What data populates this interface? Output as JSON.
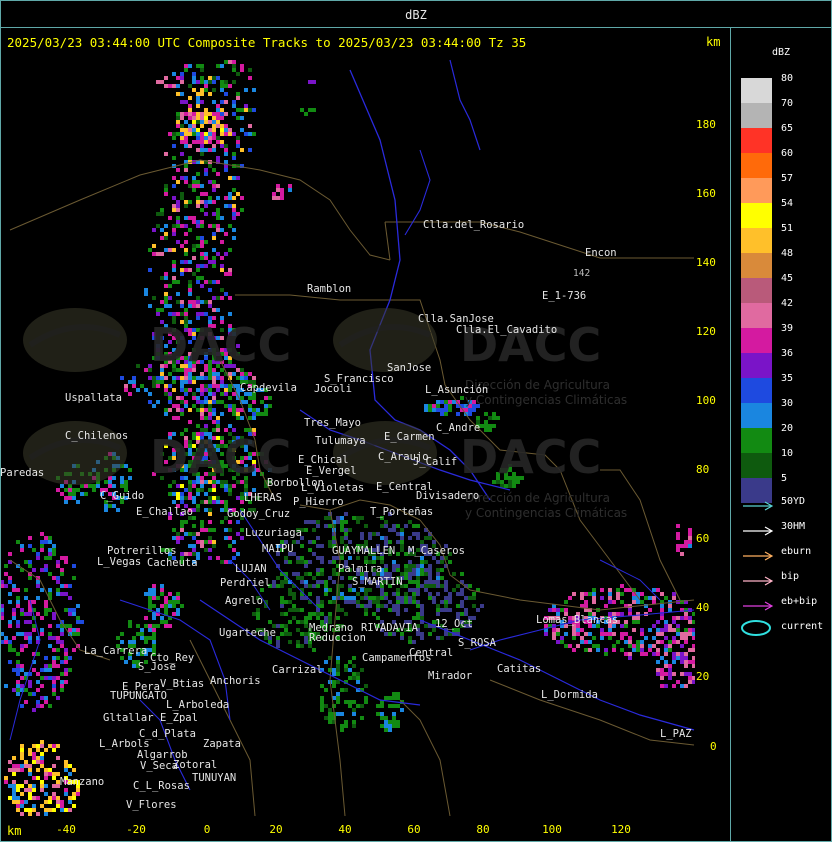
{
  "app": {
    "title": "dBZ"
  },
  "header": {
    "text": "2025/03/23 03:44:00 UTC Composite Tracks to 2025/03/23 03:44:00 Tz 35",
    "km_top": "km",
    "km_bottom": "km"
  },
  "axes": {
    "y_ticks": [
      "180",
      "160",
      "140",
      "120",
      "100",
      "80",
      "60",
      "40",
      "20",
      "0"
    ],
    "x_ticks": [
      "-40",
      "-20",
      "0",
      "20",
      "40",
      "60",
      "80",
      "100",
      "120"
    ]
  },
  "places": [
    {
      "n": "Clla.del_Rosario"
    },
    {
      "n": "Encon"
    },
    {
      "n": "142"
    },
    {
      "n": "E_1-736"
    },
    {
      "n": "Ramblon"
    },
    {
      "n": "Clla.SanJose"
    },
    {
      "n": "Clla.El_Cavadito"
    },
    {
      "n": "Uspallata"
    },
    {
      "n": "S_Francisco"
    },
    {
      "n": "Jocoli"
    },
    {
      "n": "SanJose"
    },
    {
      "n": "L_Asunción"
    },
    {
      "n": "C_Chilenos"
    },
    {
      "n": "Tres_Mayo"
    },
    {
      "n": "Tulumaya"
    },
    {
      "n": "C_Andre"
    },
    {
      "n": "E_Carmen"
    },
    {
      "n": "Paredas"
    },
    {
      "n": "E_Chical"
    },
    {
      "n": "E_Vergel"
    },
    {
      "n": "C_Araujo"
    },
    {
      "n": "J_Calif"
    },
    {
      "n": "Borbollon"
    },
    {
      "n": "L_Violetas"
    },
    {
      "n": "E_Central"
    },
    {
      "n": "Divisadero"
    },
    {
      "n": "C_Guido"
    },
    {
      "n": "P_Hierro"
    },
    {
      "n": "E_Challao"
    },
    {
      "n": "T_Porteñas"
    },
    {
      "n": "Luzuriaga"
    },
    {
      "n": "M_Caseros"
    },
    {
      "n": "Potrerillos"
    },
    {
      "n": "L_Vegas"
    },
    {
      "n": "Perdriel"
    },
    {
      "n": "S_MARTIN"
    },
    {
      "n": "Agrelo"
    },
    {
      "n": "Ugarteche"
    },
    {
      "n": "Medrano"
    },
    {
      "n": "Reduccion"
    },
    {
      "n": "RIVADAVIA"
    },
    {
      "n": "12_Oct"
    },
    {
      "n": "S_ROSA"
    },
    {
      "n": "Lomas_Blancas"
    },
    {
      "n": "La_Carrera"
    },
    {
      "n": "Cto_Rey"
    },
    {
      "n": "S_Jose"
    },
    {
      "n": "Campamentos"
    },
    {
      "n": "Central"
    },
    {
      "n": "Catitas"
    },
    {
      "n": "Carrizal"
    },
    {
      "n": "V_Btias"
    },
    {
      "n": "Anchoris"
    },
    {
      "n": "E_Pera"
    },
    {
      "n": "TUPUNGATO"
    },
    {
      "n": "Mirador"
    },
    {
      "n": "L_Arboleda"
    },
    {
      "n": "L_Dormida"
    },
    {
      "n": "Gltallar"
    },
    {
      "n": "E_Zpal"
    },
    {
      "n": "C_d_Plata"
    },
    {
      "n": "L_Arbols"
    },
    {
      "n": "Zapata"
    },
    {
      "n": "L_PAZ"
    },
    {
      "n": "Algarrob"
    },
    {
      "n": "V_Seca"
    },
    {
      "n": "Zotoral"
    },
    {
      "n": "TUNUYAN"
    },
    {
      "n": "C_L_Rosas"
    },
    {
      "n": "Manzano"
    },
    {
      "n": "V_Flores"
    },
    {
      "n": "Cacheuta"
    },
    {
      "n": "LUJAN"
    },
    {
      "n": "MAIPU"
    },
    {
      "n": "Palmira"
    },
    {
      "n": "LHERAS"
    },
    {
      "n": "GUAYMALLEN"
    },
    {
      "n": "Godoy_Cruz"
    },
    {
      "n": "Capdevila"
    }
  ],
  "watermark": {
    "brand": "DACC",
    "line1": "Dirección de Agricultura",
    "line2": "y Contingencias Climáticas"
  },
  "legend": {
    "title": "dBZ",
    "bins": [
      {
        "label": "80",
        "color": "#d8d8d8"
      },
      {
        "label": "70",
        "color": "#b4b4b4"
      },
      {
        "label": "65",
        "color": "#ff3326"
      },
      {
        "label": "60",
        "color": "#ff6a0a"
      },
      {
        "label": "57",
        "color": "#ff9a5a"
      },
      {
        "label": "54",
        "color": "#ffff00"
      },
      {
        "label": "51",
        "color": "#ffc02a"
      },
      {
        "label": "48",
        "color": "#d98a3a"
      },
      {
        "label": "45",
        "color": "#b95a7a"
      },
      {
        "label": "42",
        "color": "#e06aa0"
      },
      {
        "label": "39",
        "color": "#d41aa0"
      },
      {
        "label": "36",
        "color": "#7a14c8"
      },
      {
        "label": "35",
        "color": "#1e4ae0"
      },
      {
        "label": "30",
        "color": "#1a86e0"
      },
      {
        "label": "20",
        "color": "#128a12"
      },
      {
        "label": "10",
        "color": "#0e5a0e"
      },
      {
        "label": "5",
        "color": "#3a3a8a"
      }
    ],
    "tracks": [
      {
        "label": "50YD",
        "color": "#5ad2d2"
      },
      {
        "label": "30HM",
        "color": "#ffffff"
      },
      {
        "label": "eburn",
        "color": "#ffb060"
      },
      {
        "label": "bip",
        "color": "#ffb4c8"
      },
      {
        "label": "eb+bip",
        "color": "#e040e0"
      },
      {
        "label": "current",
        "color": "#30e0e0"
      }
    ]
  }
}
